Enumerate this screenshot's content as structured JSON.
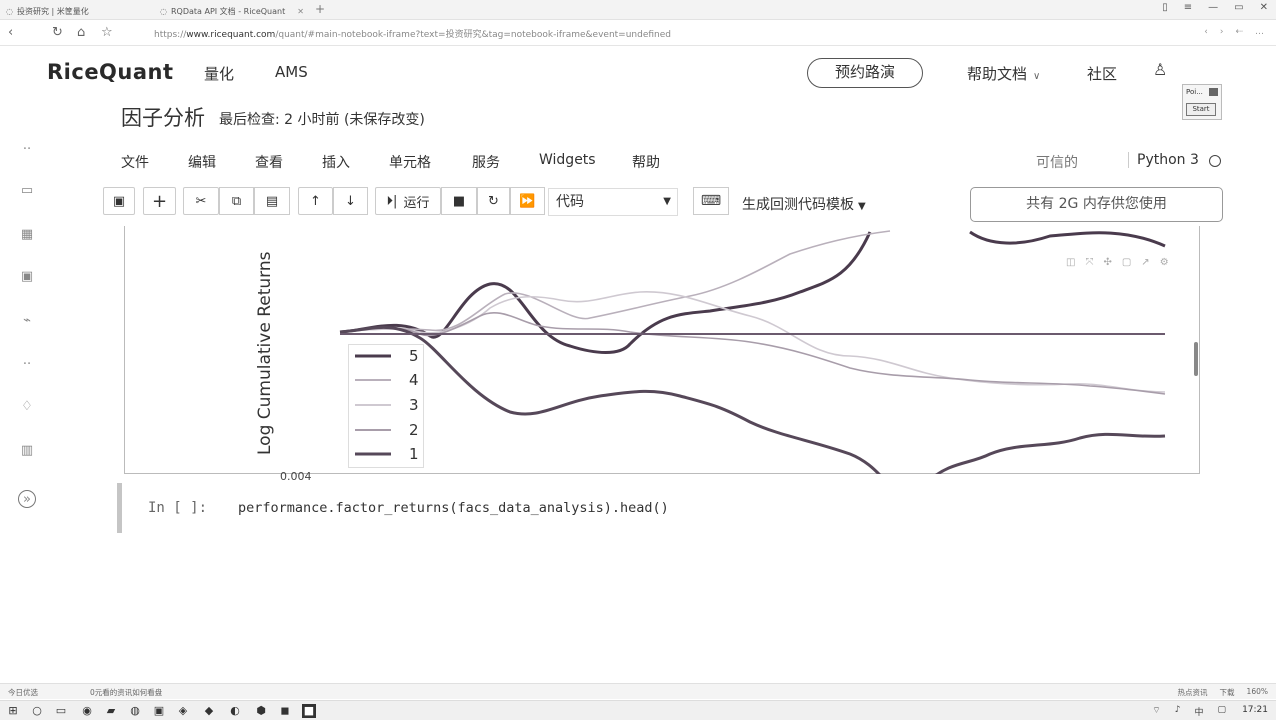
{
  "browser": {
    "tabs": [
      {
        "label": "投资研究 | 米筐量化"
      },
      {
        "label": "RQData API 文档 - RiceQuant"
      }
    ],
    "url_prefix": "https://",
    "url_host": "www.ricequant.com",
    "url_path": "/quant/#main-notebook-iframe?text=投资研究&tag=notebook-iframe&event=undefined"
  },
  "site": {
    "logo": "RiceQuant",
    "nav": [
      "量化",
      "AMS"
    ],
    "roadshow": "预约路演",
    "help": "帮助文档",
    "community": "社区",
    "widget_label": "Poi...",
    "widget_button": "Start"
  },
  "notebook": {
    "title": "因子分析",
    "checkpoint": "最后检查: 2 小时前  (未保存改变)",
    "menu": [
      "文件",
      "编辑",
      "查看",
      "插入",
      "单元格",
      "服务",
      "Widgets",
      "帮助"
    ],
    "trusted": "可信的",
    "kernel": "Python 3",
    "run_label": "运行",
    "cell_type": "代码",
    "template": "生成回测代码模板",
    "memory": "共有 2G 内存供您使用"
  },
  "icons": {
    "save": "save-icon",
    "add": "plus-icon",
    "cut": "scissors-icon",
    "copy": "copy-icon",
    "paste": "paste-icon",
    "up": "arrow-up-icon",
    "down": "arrow-down-icon",
    "stop": "stop-icon",
    "restart": "restart-icon",
    "fast_forward": "fast-forward-icon",
    "keyboard": "keyboard-icon"
  },
  "chart_data": {
    "type": "line",
    "ylabel": "Log Cumulative Returns",
    "partial_tick": "0.004",
    "legend": [
      "5",
      "4",
      "3",
      "2",
      "1"
    ],
    "series": [
      {
        "name": "5",
        "color": "#4a3b4d"
      },
      {
        "name": "4",
        "color": "#b9b0bb"
      },
      {
        "name": "3",
        "color": "#cfc9d1"
      },
      {
        "name": "2",
        "color": "#a89daa"
      },
      {
        "name": "1",
        "color": "#564859"
      }
    ],
    "baseline_color": "#6b5a6e"
  },
  "cell": {
    "prompt": "In [ ]:",
    "code": "performance.factor_returns(facs_data_analysis).head()"
  },
  "status": {
    "left": "今日优选",
    "left2": "0元看的资讯如何看盘",
    "right": [
      "热点资讯",
      "下载",
      "160%"
    ]
  },
  "taskbar": {
    "clock": "17:21",
    "tray": [
      "中"
    ]
  }
}
